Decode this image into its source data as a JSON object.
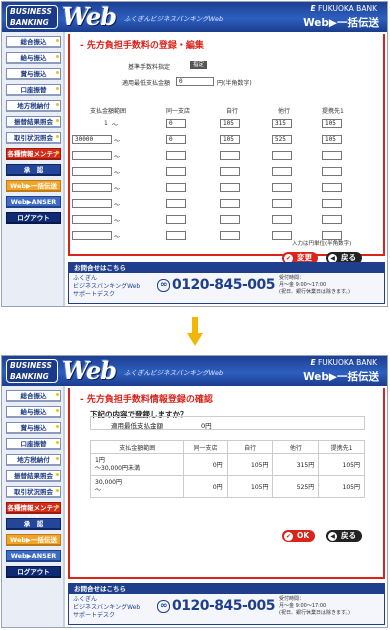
{
  "banner": {
    "logo_top": "BUSINESS",
    "logo_bottom": "BANKING",
    "web": "Web",
    "tagline": "ふくぎんビジネスバンキングWeb",
    "bank": "FUKUOKA BANK",
    "bank_mark": "E",
    "product": "Web▶一括伝送"
  },
  "sidebar": {
    "items": [
      {
        "label": "総合振込"
      },
      {
        "label": "給与振込"
      },
      {
        "label": "賞与振込"
      },
      {
        "label": "口座振替"
      },
      {
        "label": "地方税納付"
      },
      {
        "label": "振替結果照会"
      },
      {
        "label": "取引状況照会"
      },
      {
        "label": "各種情報メンテナンス"
      },
      {
        "label": "承　認"
      },
      {
        "label": "Web▶一括伝送"
      },
      {
        "label": "Web▶ANSER"
      },
      {
        "label": "ログアウト"
      }
    ]
  },
  "form_screen": {
    "title": "先方負担手数料の登録・編集",
    "basic_label": "基準手数料指定",
    "basic_badge": "指定",
    "amount_label": "適用最低支払金額",
    "amount_value": "0",
    "amount_hint": "円(半角数字)",
    "headers": [
      "支払金額範囲",
      "同一支店",
      "自行",
      "他行",
      "提携先1"
    ],
    "rows": [
      {
        "from": "1",
        "to_label": "～",
        "same": "0",
        "own": "105",
        "other": "315",
        "partner": "105"
      },
      {
        "from": "30000",
        "to_label": "～",
        "same": "0",
        "own": "105",
        "other": "525",
        "partner": "105"
      }
    ],
    "empty_rows": 6,
    "note": "入力は円単位(半角数字)",
    "change_button": "変更",
    "back_button": "戻る"
  },
  "confirm_screen": {
    "title": "先方負担手数料情報登録の確認",
    "question": "下記の内容で登録しますか？",
    "amount_label": "適用最低支払金額",
    "amount_value": "0円",
    "headers": [
      "支払金額範囲",
      "同一支店",
      "自行",
      "他行",
      "提携先1"
    ],
    "rows": [
      {
        "range": "1円\n～30,000円未満",
        "same": "0円",
        "own": "105円",
        "other": "315円",
        "partner": "105円"
      },
      {
        "range": "30,000円\n～",
        "same": "0円",
        "own": "105円",
        "other": "525円",
        "partner": "105円"
      }
    ],
    "ok_button": "OK",
    "back_button": "戻る"
  },
  "contact": {
    "header": "お問合せはこちら",
    "line1": "ふくぎん",
    "line2": "ビジネスバンキングWeb",
    "line3": "サポートデスク",
    "phone": "0120-845-005",
    "hours1": "受付時間：",
    "hours2": "月～金 9:00～17:00",
    "hours3": "(祝日、銀行休業日は除きます。)"
  },
  "colors": {
    "accent": "#d9241c",
    "brand": "#1f3f8c",
    "arrow": "#f2b705"
  }
}
